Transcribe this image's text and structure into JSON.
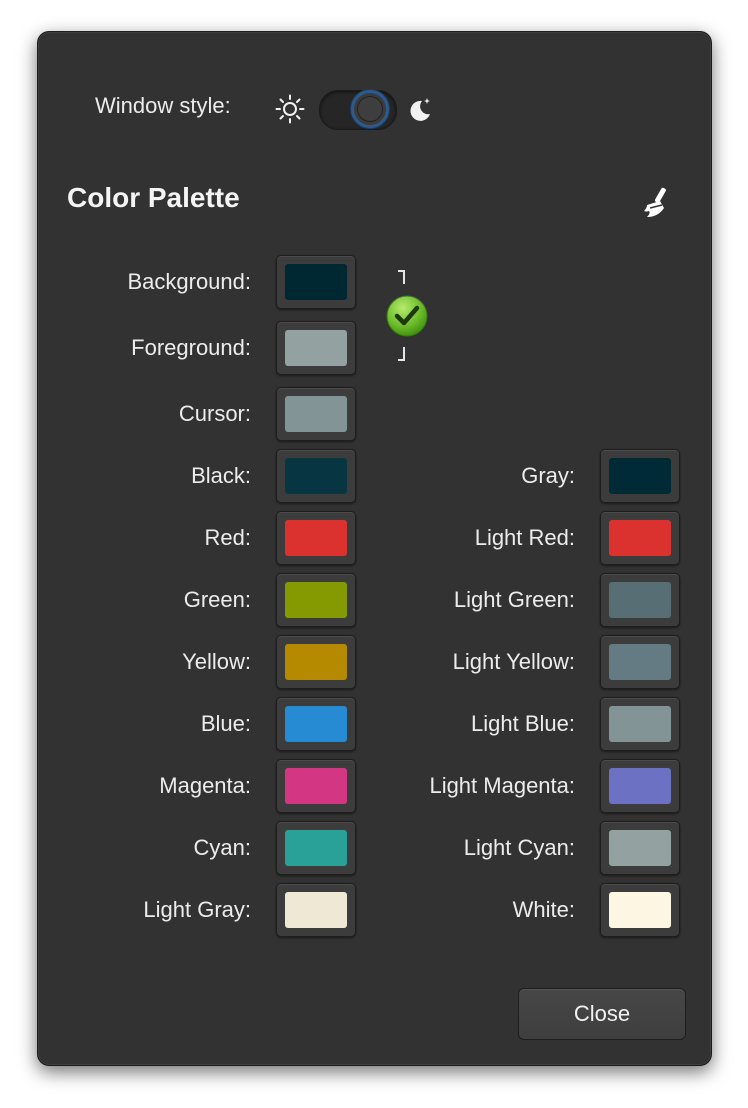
{
  "window_style": {
    "label": "Window style:",
    "icons": {
      "light": "sun-icon",
      "dark": "moon-icon"
    },
    "mode": "dark"
  },
  "palette": {
    "title": "Color Palette",
    "reset_icon": "broom-icon",
    "link_icon": "checkmark-icon",
    "basic": [
      {
        "label": "Background:",
        "color": "#002833"
      },
      {
        "label": "Foreground:",
        "color": "#93a1a1"
      },
      {
        "label": "Cursor:",
        "color": "#839496"
      }
    ],
    "left": [
      {
        "label": "Black:",
        "color": "#073642"
      },
      {
        "label": "Red:",
        "color": "#dc322f"
      },
      {
        "label": "Green:",
        "color": "#859900"
      },
      {
        "label": "Yellow:",
        "color": "#b58900"
      },
      {
        "label": "Blue:",
        "color": "#268bd2"
      },
      {
        "label": "Magenta:",
        "color": "#d33682"
      },
      {
        "label": "Cyan:",
        "color": "#2aa198"
      },
      {
        "label": "Light Gray:",
        "color": "#eee8d5"
      }
    ],
    "right": [
      {
        "label": "Gray:",
        "color": "#002b36"
      },
      {
        "label": "Light Red:",
        "color": "#dc322f"
      },
      {
        "label": "Light Green:",
        "color": "#586e75"
      },
      {
        "label": "Light Yellow:",
        "color": "#657b83"
      },
      {
        "label": "Light Blue:",
        "color": "#839496"
      },
      {
        "label": "Light Magenta:",
        "color": "#6c71c4"
      },
      {
        "label": "Light Cyan:",
        "color": "#93a1a1"
      },
      {
        "label": "White:",
        "color": "#fdf6e3"
      }
    ]
  },
  "close_label": "Close"
}
